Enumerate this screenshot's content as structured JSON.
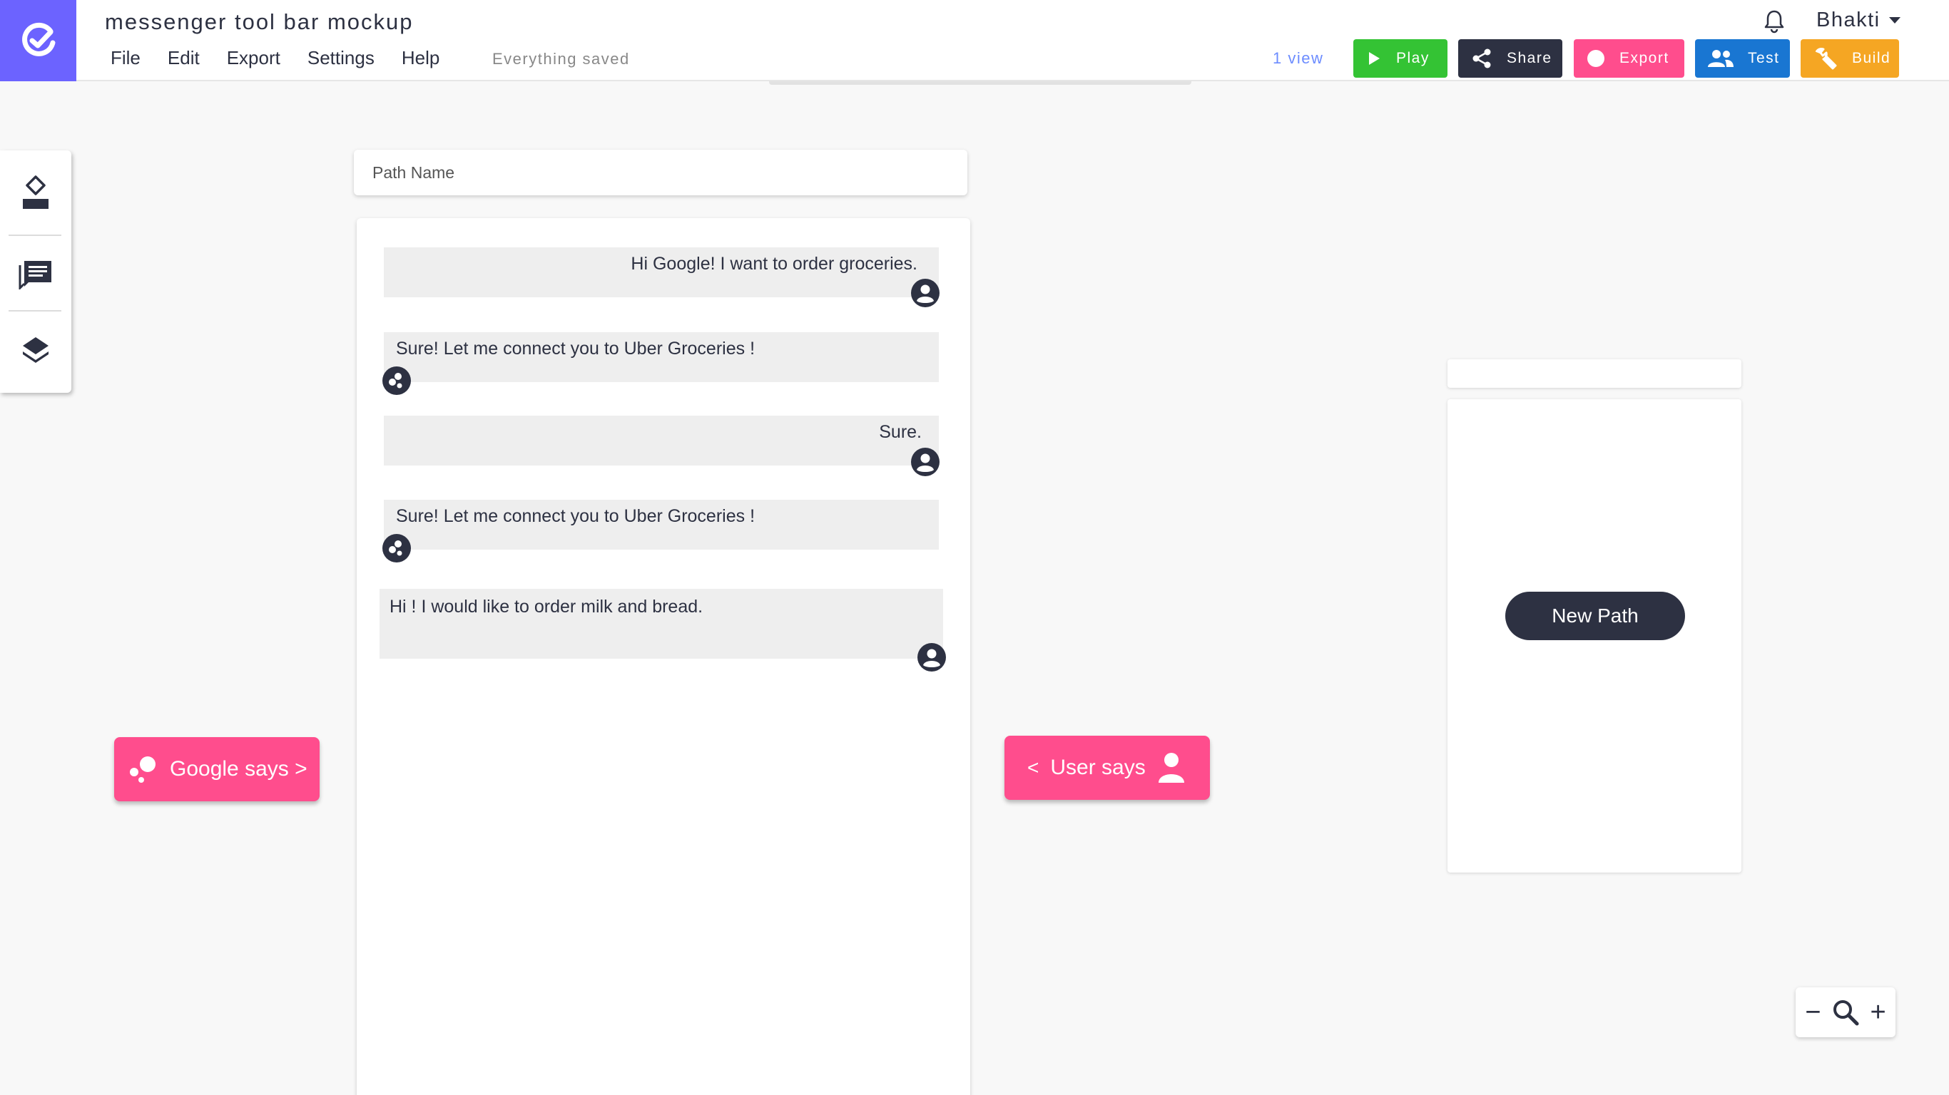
{
  "app": {
    "title": "messenger tool bar mockup",
    "status": "Everything saved",
    "views": "1 view"
  },
  "menu": [
    "File",
    "Edit",
    "Export",
    "Settings",
    "Help"
  ],
  "toolbar": {
    "play": "Play",
    "share": "Share",
    "export": "Export",
    "test": "Test",
    "build": "Build"
  },
  "user": {
    "name": "Bhakti"
  },
  "path": {
    "placeholder": "Path Name",
    "messages": [
      {
        "speaker": "user",
        "text": "Hi Google! I want to order groceries."
      },
      {
        "speaker": "google",
        "text": "Sure! Let me connect you to Uber Groceries !"
      },
      {
        "speaker": "user",
        "text": "Sure."
      },
      {
        "speaker": "google",
        "text": "Sure! Let me connect you to Uber Groceries !"
      },
      {
        "speaker": "user",
        "text": "Hi ! I would like to order milk and bread."
      }
    ]
  },
  "actions": {
    "google_says": "Google says >",
    "user_says_prefix": "<",
    "user_says": "User says",
    "new_path": "New Path"
  },
  "zoom": {
    "minus": "−",
    "plus": "+"
  },
  "colors": {
    "brand": "#6c63ff",
    "dark": "#2d3142",
    "pink": "#ff4d8d",
    "green": "#34c334",
    "blue": "#1976d2",
    "orange": "#f5a623",
    "bubble": "#eeeeee"
  }
}
